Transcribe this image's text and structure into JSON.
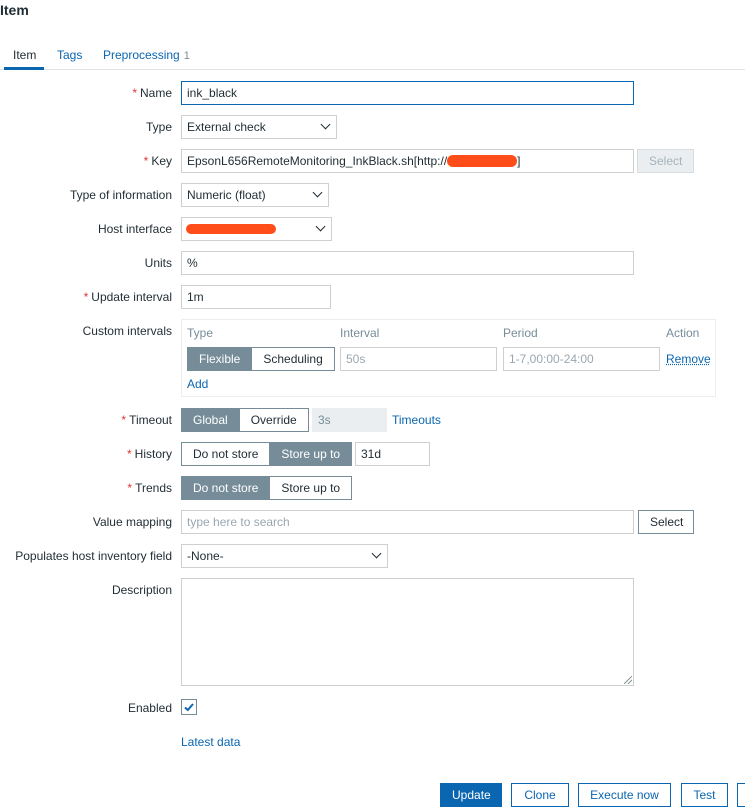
{
  "page": {
    "title": "Item"
  },
  "tabs": [
    {
      "label": "Item"
    },
    {
      "label": "Tags"
    },
    {
      "label": "Preprocessing",
      "count": "1"
    }
  ],
  "form": {
    "name": {
      "label": "Name",
      "value": "ink_black"
    },
    "type": {
      "label": "Type",
      "value": "External check"
    },
    "key": {
      "label": "Key",
      "value": "EpsonL656RemoteMonitoring_InkBlack.sh[http://",
      "value_suffix": "]",
      "select_label": "Select"
    },
    "type_of_information": {
      "label": "Type of information",
      "value": "Numeric (float)"
    },
    "host_interface": {
      "label": "Host interface"
    },
    "units": {
      "label": "Units",
      "value": "%"
    },
    "update_interval": {
      "label": "Update interval",
      "value": "1m"
    },
    "custom_intervals": {
      "label": "Custom intervals",
      "headers": {
        "type": "Type",
        "interval": "Interval",
        "period": "Period",
        "action": "Action"
      },
      "row": {
        "type_options": [
          "Flexible",
          "Scheduling"
        ],
        "interval_placeholder": "50s",
        "period_placeholder": "1-7,00:00-24:00",
        "remove_label": "Remove"
      },
      "add_label": "Add"
    },
    "timeout": {
      "label": "Timeout",
      "options": [
        "Global",
        "Override"
      ],
      "value": "3s",
      "link": "Timeouts"
    },
    "history": {
      "label": "History",
      "options": [
        "Do not store",
        "Store up to"
      ],
      "value": "31d"
    },
    "trends": {
      "label": "Trends",
      "options": [
        "Do not store",
        "Store up to"
      ]
    },
    "value_mapping": {
      "label": "Value mapping",
      "placeholder": "type here to search",
      "select_label": "Select"
    },
    "inventory_field": {
      "label": "Populates host inventory field",
      "value": "-None-"
    },
    "description": {
      "label": "Description",
      "value": ""
    },
    "enabled": {
      "label": "Enabled",
      "checked": true
    },
    "latest_data_link": "Latest data"
  },
  "actions": {
    "update": "Update",
    "clone": "Clone",
    "execute_now": "Execute now",
    "test": "Test"
  },
  "colors": {
    "accent": "#0a66b0",
    "required": "#e33734",
    "segment_active": "#768d99"
  }
}
